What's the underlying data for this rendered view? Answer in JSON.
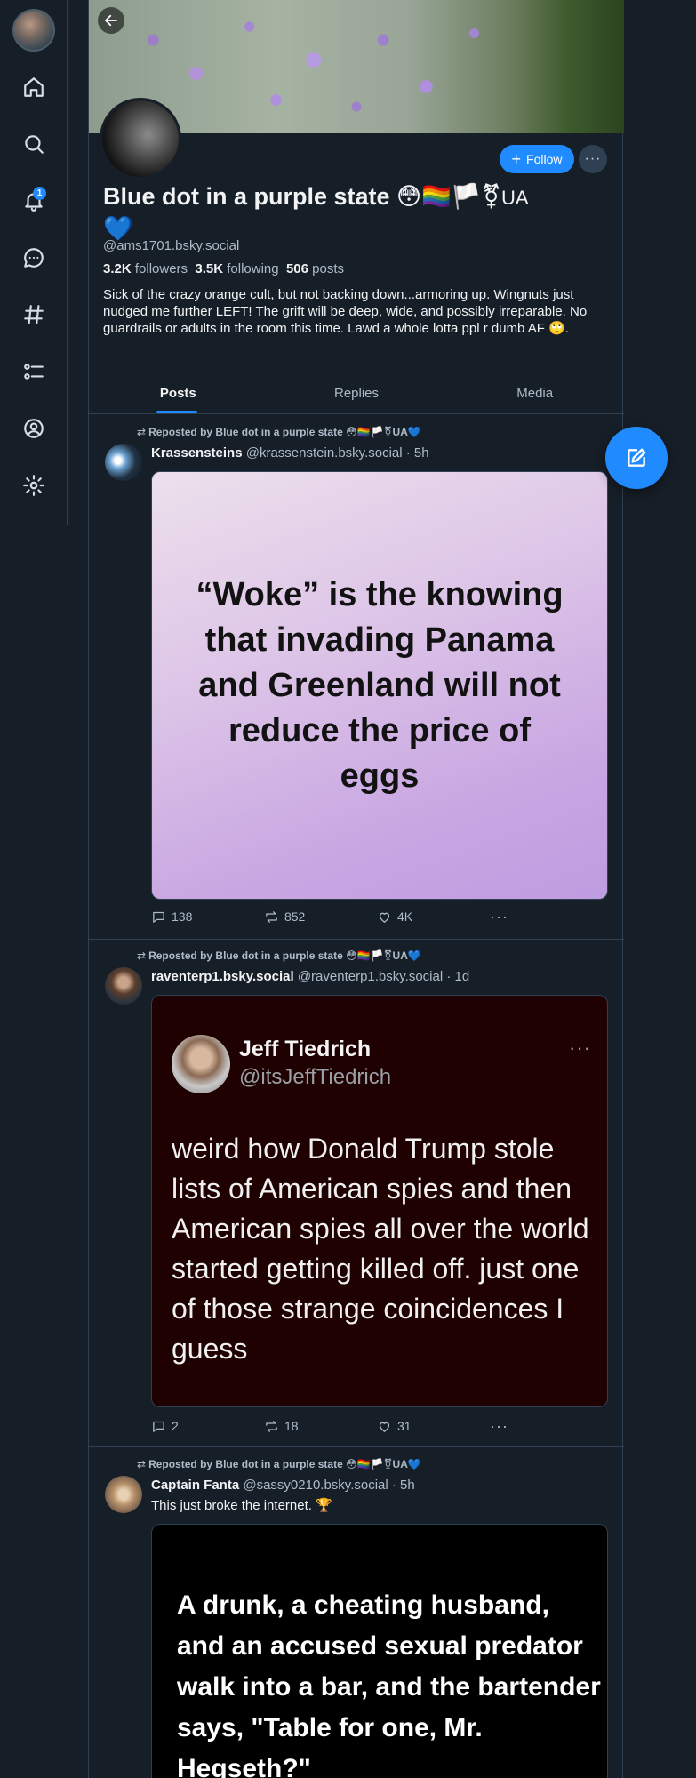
{
  "profile": {
    "display_name": "Blue dot in a purple state 😳🏳️‍🌈🏳️⚧",
    "name_suffix": "UA",
    "name_heart": "💙",
    "handle": "@ams1701.bsky.social",
    "followers_count": "3.2K",
    "followers_label": "followers",
    "following_count": "3.5K",
    "following_label": "following",
    "posts_count": "506",
    "posts_label": "posts",
    "bio": "Sick of the crazy orange cult, but not backing down...armoring up. Wingnuts just nudged me further LEFT! The grift will be deep, wide, and possibly irreparable. No guardrails or adults in the room this time. Lawd a whole lotta ppl r dumb AF 🙄.",
    "follow_label": "Follow",
    "more_label": "···"
  },
  "rail": {
    "notification_count": "1"
  },
  "tabs": [
    {
      "label": "Posts"
    },
    {
      "label": "Replies"
    },
    {
      "label": "Media"
    }
  ],
  "posts": [
    {
      "repost_label": "Reposted by Blue dot in a purple state 😳🏳️‍🌈🏳️⚧UA💙",
      "author": "Krassensteins",
      "meta": "@krassenstein.bsky.social · 5h",
      "image_text": "“Woke” is the knowing that invading Panama and Greenland will not reduce the price of eggs",
      "replies": "138",
      "reposts": "852",
      "likes": "4K",
      "more": "···"
    },
    {
      "repost_label": "Reposted by Blue dot in a purple state 😳🏳️‍🌈🏳️⚧UA💙",
      "author": "raventerp1.bsky.social",
      "meta": "@raventerp1.bsky.social · 1d",
      "tweet_name": "Jeff Tiedrich",
      "tweet_handle": "@itsJeffTiedrich",
      "tweet_dots": "···",
      "tweet_body": "weird how Donald Trump stole lists of American spies and then American spies all over the world started getting killed off. just one of those strange coincidences I guess",
      "replies": "2",
      "reposts": "18",
      "likes": "31",
      "more": "···"
    },
    {
      "repost_label": "Reposted by Blue dot in a purple state 😳🏳️‍🌈🏳️⚧UA💙",
      "author": "Captain Fanta",
      "meta": "@sassy0210.bsky.social · 5h",
      "text": "This just broke the internet. 🏆",
      "image_text": "A drunk, a cheating husband, and an accused sexual predator walk into a bar, and the bartender says, \"Table for one, Mr. Hegseth?\""
    }
  ]
}
